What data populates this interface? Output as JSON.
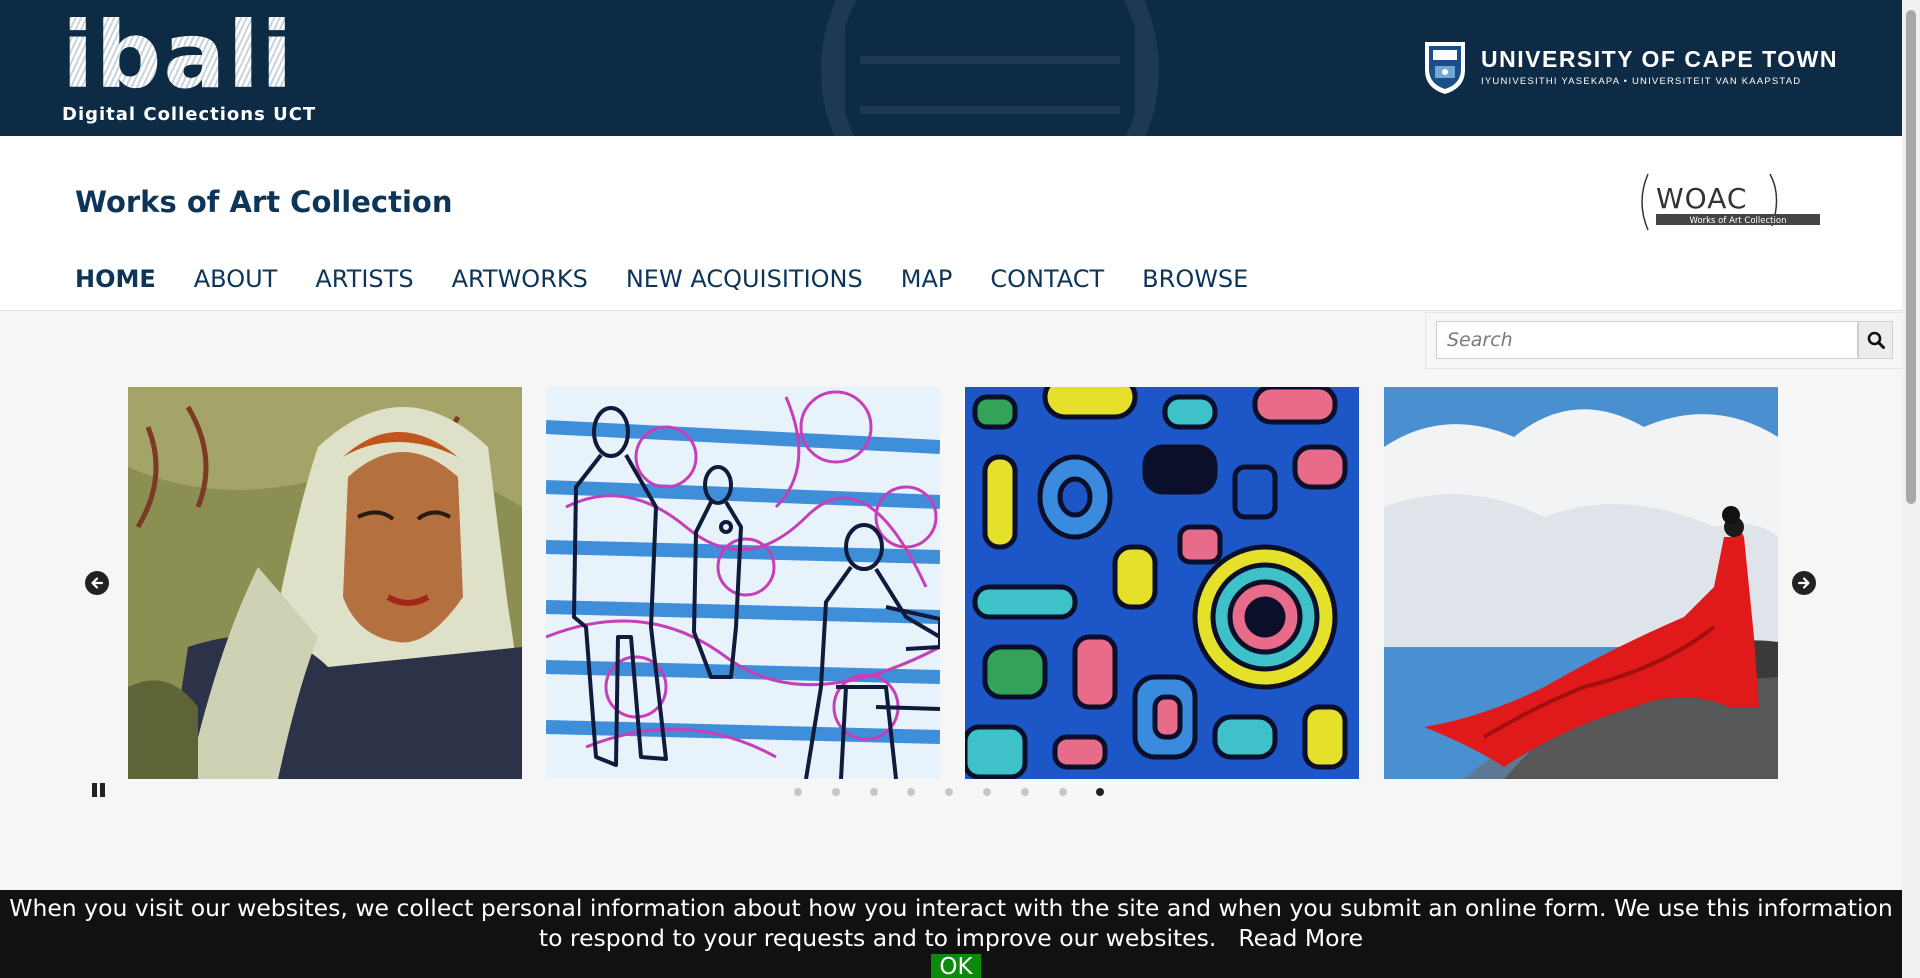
{
  "banner": {
    "logo_word": "ibali",
    "logo_subtitle": "Digital Collections UCT",
    "university_name": "UNIVERSITY OF CAPE TOWN",
    "university_tagline": "IYUNIVESITHI YASEKAPA • UNIVERSITEIT VAN KAAPSTAD"
  },
  "header": {
    "site_title": "Works of Art Collection",
    "woac_logo_text": "WOAC",
    "woac_logo_subtext": "Works of Art Collection"
  },
  "nav": {
    "items": [
      {
        "label": "HOME",
        "active": true
      },
      {
        "label": "ABOUT",
        "active": false
      },
      {
        "label": "ARTISTS",
        "active": false
      },
      {
        "label": "ARTWORKS",
        "active": false
      },
      {
        "label": "NEW ACQUISITIONS",
        "active": false
      },
      {
        "label": "MAP",
        "active": false
      },
      {
        "label": "CONTACT",
        "active": false
      },
      {
        "label": "BROWSE",
        "active": false
      }
    ]
  },
  "search": {
    "placeholder": "Search",
    "value": "",
    "icon": "search-icon"
  },
  "carousel": {
    "slides": [
      {
        "subject": "portrait-woman-white-headscarf"
      },
      {
        "subject": "figures-line-drawing-blue-pink"
      },
      {
        "subject": "abstract-colorful-shapes-blue"
      },
      {
        "subject": "figure-red-dress-clouds"
      }
    ],
    "dot_count": 9,
    "active_dot": 8,
    "prev_icon": "arrow-left-circle-icon",
    "next_icon": "arrow-right-circle-icon",
    "pause_icon": "pause-icon"
  },
  "cookie": {
    "message": "When you visit our websites, we collect personal information about how you interact with the site and when you submit an online form. We use this information to respond to your requests and to improve our websites.",
    "read_more": "Read More",
    "ok": "OK"
  },
  "colors": {
    "banner_bg": "#0d2b45",
    "brand_blue": "#0d3558",
    "cookie_bg": "#111111",
    "ok_green": "#0b8a0b"
  }
}
